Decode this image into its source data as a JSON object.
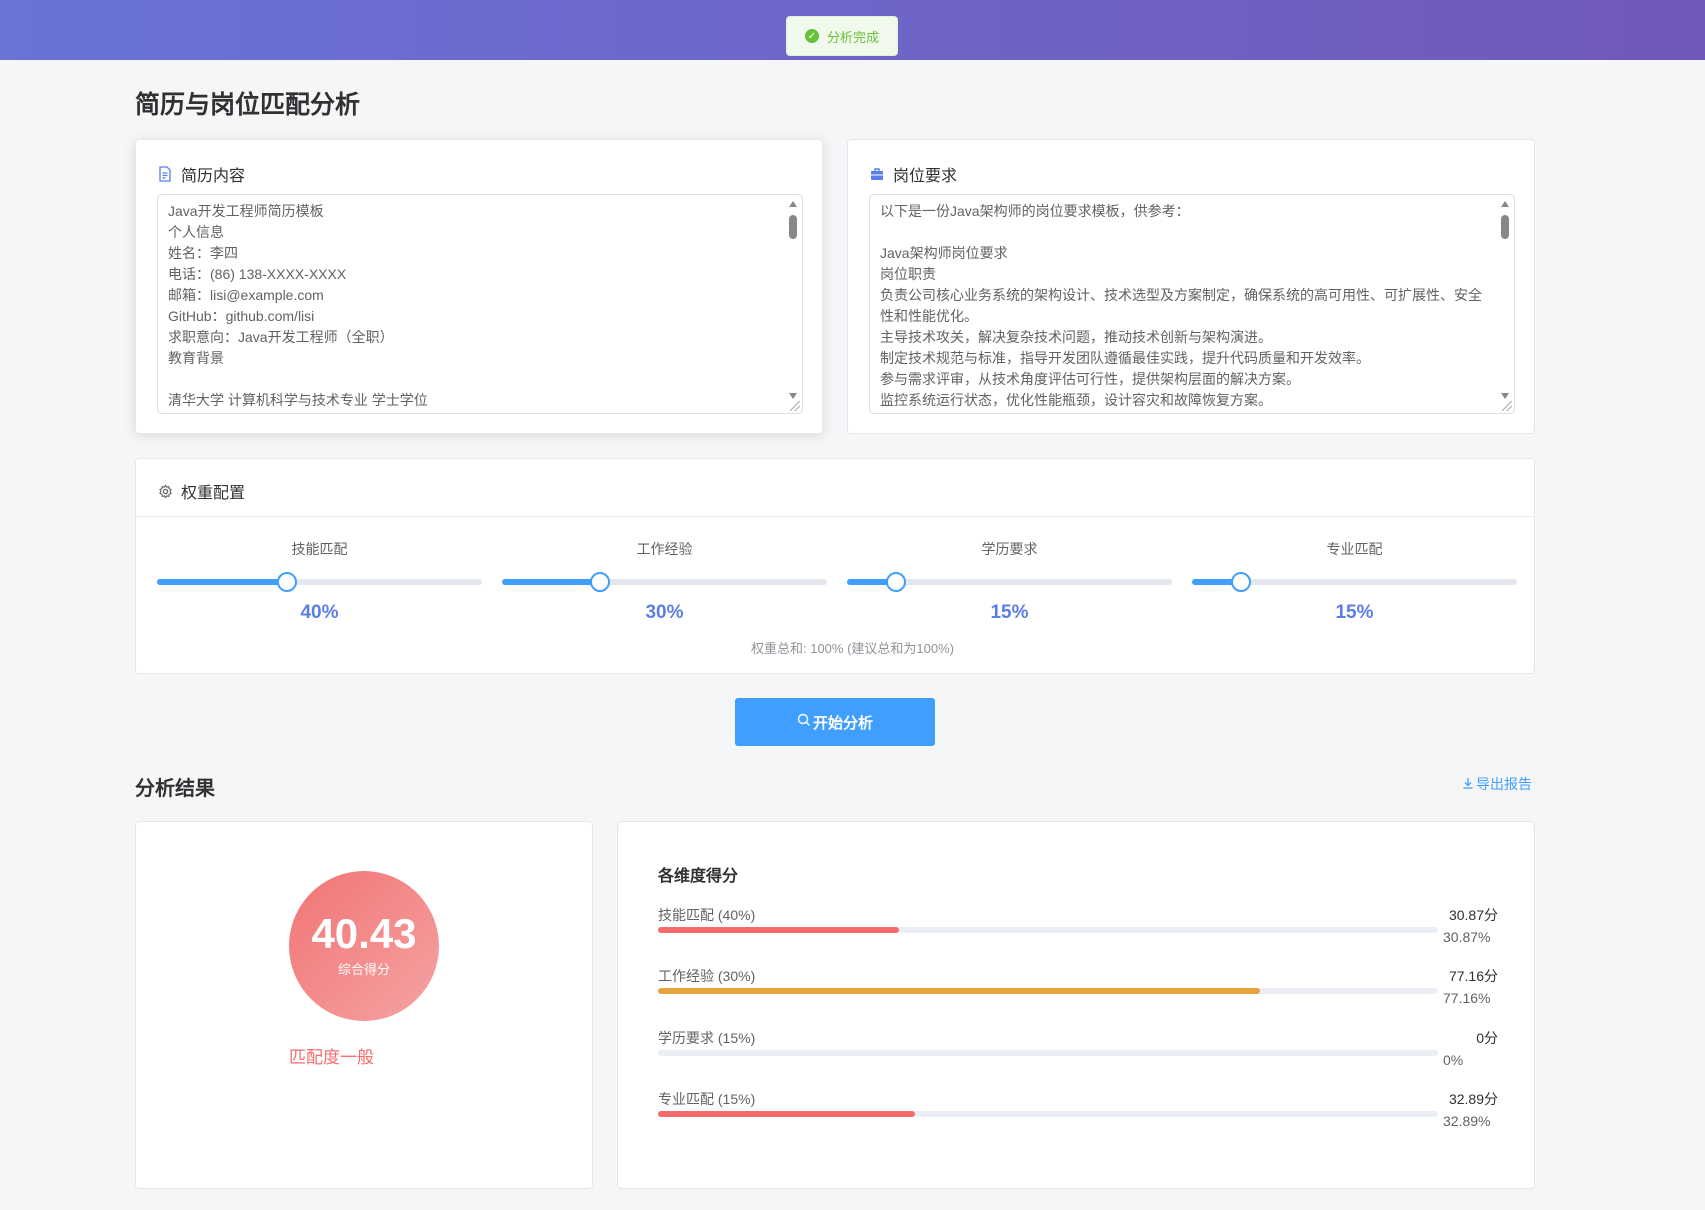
{
  "toast": {
    "text": "分析完成"
  },
  "page_title": "简历与岗位匹配分析",
  "resume": {
    "title": "简历内容",
    "content": "Java开发工程师简历模板\n个人信息\n姓名：李四\n电话：(86) 138-XXXX-XXXX\n邮箱：lisi@example.com\nGitHub：github.com/lisi\n求职意向：Java开发工程师（全职）\n教育背景\n\n清华大学 计算机科学与技术专业 学士学位"
  },
  "job": {
    "title": "岗位要求",
    "content": "以下是一份Java架构师的岗位要求模板，供参考：\n\nJava架构师岗位要求\n岗位职责\n负责公司核心业务系统的架构设计、技术选型及方案制定，确保系统的高可用性、可扩展性、安全性和性能优化。\n主导技术攻关，解决复杂技术问题，推动技术创新与架构演进。\n制定技术规范与标准，指导开发团队遵循最佳实践，提升代码质量和开发效率。\n参与需求评审，从技术角度评估可行性，提供架构层面的解决方案。\n监控系统运行状态，优化性能瓶颈，设计容灾和故障恢复方案。"
  },
  "weights": {
    "title": "权重配置",
    "items": [
      {
        "label": "技能匹配",
        "value": 40,
        "display": "40%"
      },
      {
        "label": "工作经验",
        "value": 30,
        "display": "30%"
      },
      {
        "label": "学历要求",
        "value": 15,
        "display": "15%"
      },
      {
        "label": "专业匹配",
        "value": 15,
        "display": "15%"
      }
    ],
    "sum_text": "权重总和: 100% (建议总和为100%)"
  },
  "analyze_button": "开始分析",
  "results": {
    "title": "分析结果",
    "export_label": "导出报告",
    "score": "40.43",
    "score_label": "综合得分",
    "match_level": "匹配度一般",
    "dimensions_title": "各维度得分",
    "dimensions": [
      {
        "name": "技能匹配 (40%)",
        "score": "30.87分",
        "percent": "30.87%",
        "value": 30.87,
        "color": "#f56c6c"
      },
      {
        "name": "工作经验 (30%)",
        "score": "77.16分",
        "percent": "77.16%",
        "value": 77.16,
        "color": "#e6a23c"
      },
      {
        "name": "学历要求 (15%)",
        "score": "0分",
        "percent": "0%",
        "value": 0,
        "color": "#f56c6c"
      },
      {
        "name": "专业匹配 (15%)",
        "score": "32.89分",
        "percent": "32.89%",
        "value": 32.89,
        "color": "#f56c6c"
      }
    ]
  },
  "colors": {
    "primary": "#409eff",
    "success": "#67c23a",
    "danger": "#f56c6c",
    "warning": "#e6a23c",
    "header_gradient_start": "#6a73d8",
    "header_gradient_end": "#7158b8"
  }
}
